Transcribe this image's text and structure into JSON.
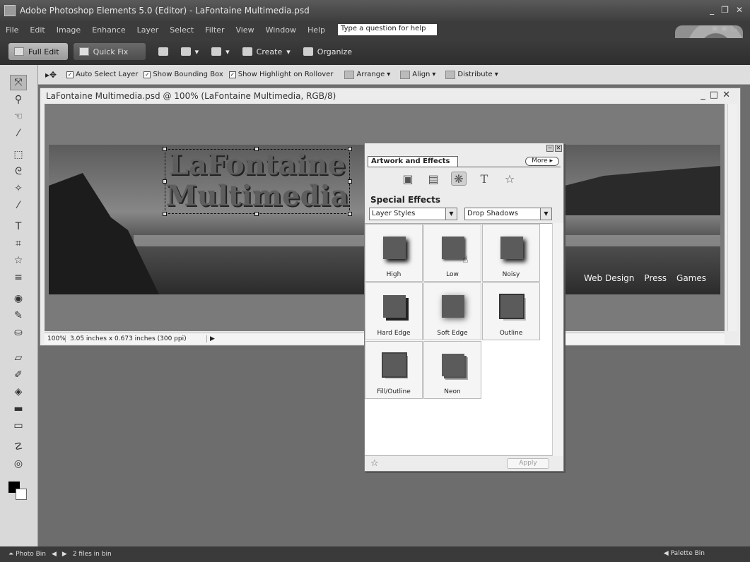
{
  "window": {
    "title": "Adobe Photoshop Elements 5.0 (Editor) - LaFontaine Multimedia.psd"
  },
  "menubar": {
    "items": [
      "File",
      "Edit",
      "Image",
      "Enhance",
      "Layer",
      "Select",
      "Filter",
      "View",
      "Window",
      "Help"
    ],
    "help_placeholder": "Type a question for help"
  },
  "modebar": {
    "full_edit": "Full Edit",
    "quick_fix": "Quick Fix",
    "create": "Create",
    "organize": "Organize"
  },
  "options": {
    "auto_select_layer": "Auto Select Layer",
    "show_bounding_box": "Show Bounding Box",
    "show_highlight": "Show Highlight on Rollover",
    "arrange": "Arrange",
    "align": "Align",
    "distribute": "Distribute"
  },
  "document": {
    "title": "LaFontaine Multimedia.psd @ 100% (LaFontaine  Multimedia, RGB/8)",
    "banner_line1": "LaFontaine",
    "banner_line2": "Multimedia",
    "nav": [
      "Web Design",
      "Press",
      "Games"
    ],
    "zoom": "100%",
    "size_info": "3.05 inches x 0.673 inches (300 ppi)"
  },
  "palette": {
    "tab": "Artwork and Effects",
    "more": "More",
    "section_title": "Special Effects",
    "dropdown1": "Layer Styles",
    "dropdown2": "Drop Shadows",
    "styles": [
      "High",
      "Low",
      "Noisy",
      "Hard Edge",
      "Soft Edge",
      "Outline",
      "Fill/Outline",
      "Neon"
    ],
    "apply": "Apply"
  },
  "bottombar": {
    "photo_bin": "Photo Bin",
    "files": "2 files in bin",
    "palette_bin": "Palette Bin"
  }
}
